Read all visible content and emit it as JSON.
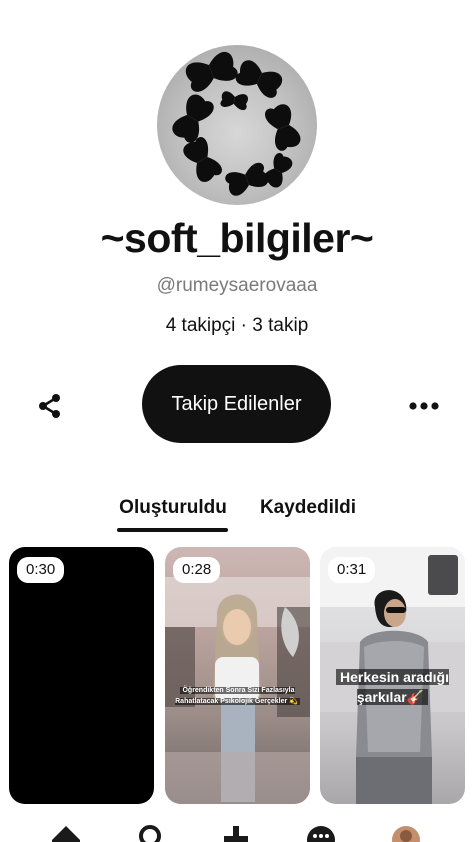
{
  "profile": {
    "display_name": "~soft_bilgiler~",
    "username": "@rumeysaerovaaa",
    "stats": "4 takipçi · 3 takip",
    "avatar_icon": "butterfly-avatar"
  },
  "actions": {
    "share_icon": "share-icon",
    "follow_label": "Takip Edilenler",
    "more_icon": "more-icon"
  },
  "tabs": [
    {
      "label": "Oluşturuldu",
      "selected": true
    },
    {
      "label": "Kaydedildi",
      "selected": false
    }
  ],
  "pins": [
    {
      "duration": "0:30",
      "caption": ""
    },
    {
      "duration": "0:28",
      "caption": "Öğrendikten Sonra Sizi Fazlasıyla Rahatlatacak Psikolojik Gerçekler 💫"
    },
    {
      "duration": "0:31",
      "caption": "Herkesin aradığı şarkılar🎸"
    }
  ],
  "bottom_nav": [
    "home-icon",
    "search-icon",
    "add-icon",
    "messages-icon",
    "profile-avatar"
  ],
  "colors": {
    "primary": "#111111",
    "secondary_text": "#7a7a7a",
    "background": "#ffffff"
  }
}
